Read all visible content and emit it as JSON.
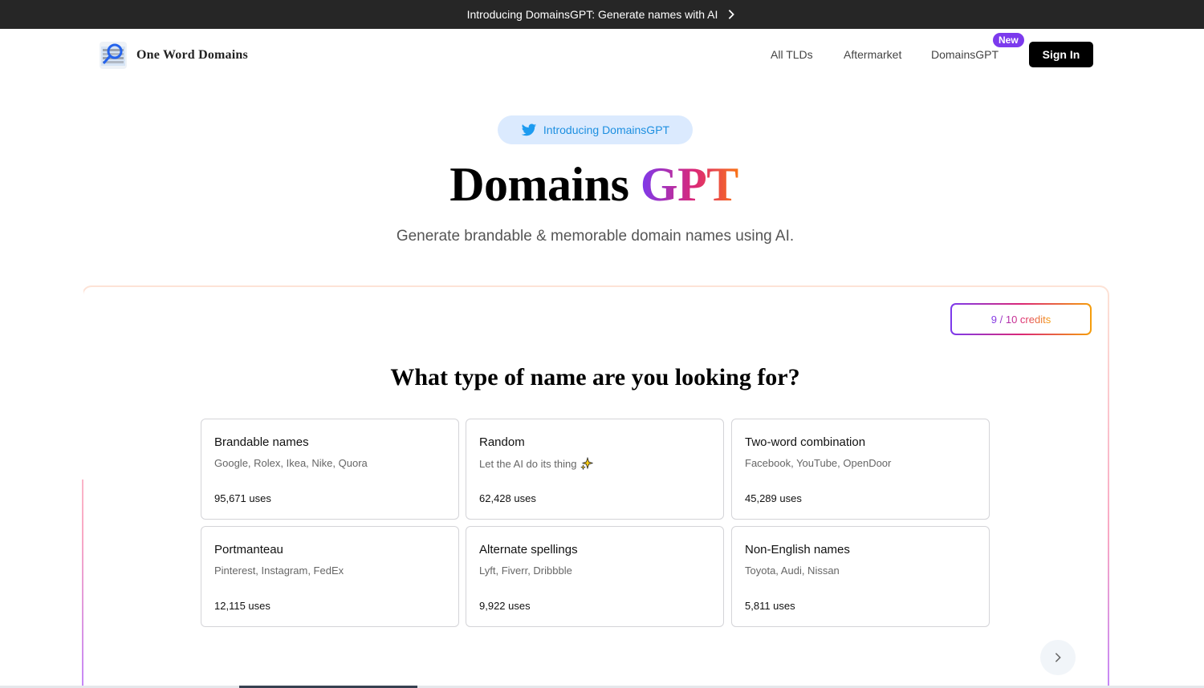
{
  "banner": {
    "text": "Introducing DomainsGPT: Generate names with AI"
  },
  "nav": {
    "brand": "One Word Domains",
    "links": [
      "All TLDs",
      "Aftermarket",
      "DomainsGPT"
    ],
    "new_badge": "New",
    "sign_in": "Sign In"
  },
  "hero": {
    "pill": "Introducing DomainsGPT",
    "title_main": "Domains",
    "title_accent": "GPT",
    "subtitle": "Generate brandable & memorable domain names using AI."
  },
  "panel": {
    "credits": "9 / 10 credits",
    "question": "What type of name are you looking for?",
    "cards": [
      {
        "title": "Brandable names",
        "desc": "Google, Rolex, Ikea, Nike, Quora",
        "uses": "95,671 uses"
      },
      {
        "title": "Random",
        "desc": "Let the AI do its thing",
        "uses": "62,428 uses",
        "icon": "sparkles-icon"
      },
      {
        "title": "Two-word combination",
        "desc": "Facebook, YouTube, OpenDoor",
        "uses": "45,289 uses"
      },
      {
        "title": "Portmanteau",
        "desc": "Pinterest, Instagram, FedEx",
        "uses": "12,115 uses"
      },
      {
        "title": "Alternate spellings",
        "desc": "Lyft, Fiverr, Dribbble",
        "uses": "9,922 uses"
      },
      {
        "title": "Non-English names",
        "desc": "Toyota, Audi, Nissan",
        "uses": "5,811 uses"
      }
    ]
  },
  "colors": {
    "banner_bg": "#262626",
    "accent_purple": "#7c3aed",
    "accent_pink": "#db2777",
    "accent_orange": "#f97316",
    "twitter_blue": "#1d8fe0"
  }
}
